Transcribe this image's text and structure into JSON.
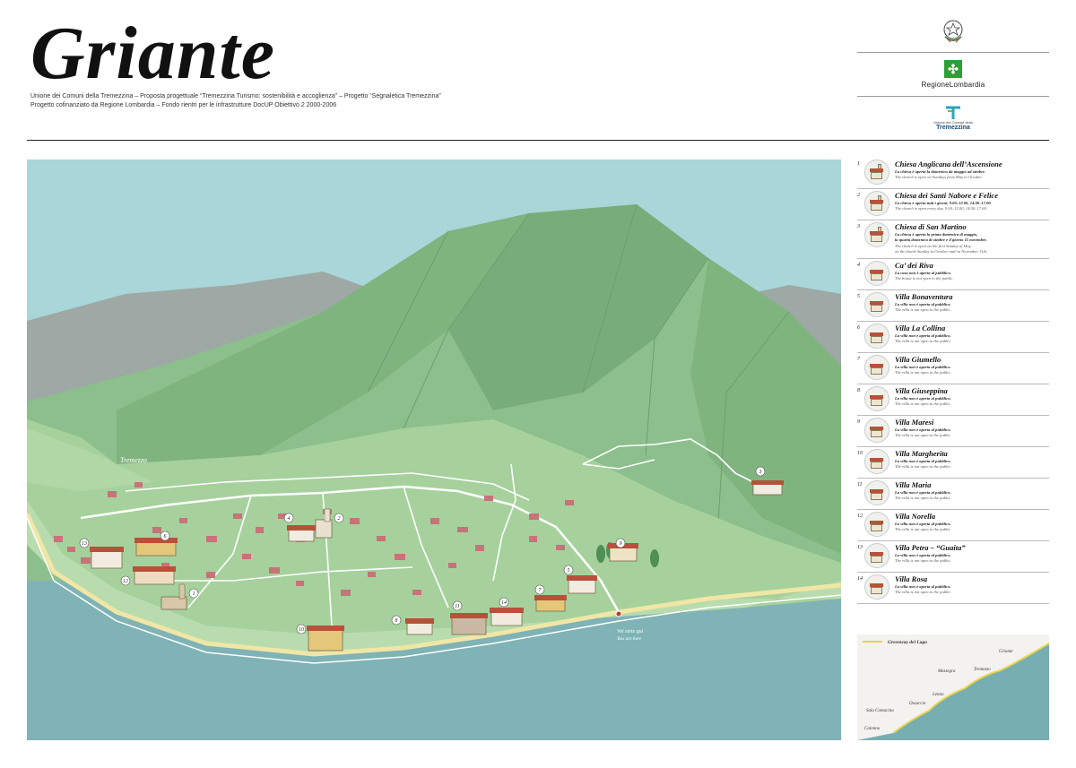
{
  "header": {
    "title": "Griante",
    "subtitle_line1": "Unione dei Comuni della Tremezzina – Proposta progettuale “Tremezzina Turismo: sostenibilità e accoglienza” – Progetto “Segnaletica Tremezzina”",
    "subtitle_line2": "Progetto cofinanziato da Regione Lombardia – Fondo rientri per le infrastrutture DocUP Obiettivo 2 2000-2006"
  },
  "logos": {
    "emblem_icon": "italian-republic-emblem-icon",
    "regione": "RegioneLombardia",
    "tremezzina_small": "Unione dei Comuni della",
    "tremezzina": "Tremezzina"
  },
  "map": {
    "place_tremezzo": "Tremezzo",
    "you_are_here_it": "Voi siete qui",
    "you_are_here_en": "You are here",
    "markers": [
      "1",
      "2",
      "3",
      "4",
      "5",
      "6",
      "7",
      "8",
      "9",
      "10",
      "11",
      "12",
      "13",
      "14"
    ],
    "colors": {
      "lake": "#7fb3b5",
      "sky": "#a9d6d8",
      "mountain": "#8fc08f",
      "land": "#b2d7a6",
      "roofs": "#c8727a",
      "road": "#ffffff",
      "shore": "#f0e6a6"
    }
  },
  "legend": [
    {
      "num": "1",
      "name": "Chiesa Anglicana dell’Ascensione",
      "it": [
        "La chiesa è aperta la domenica da maggio ad ottobre."
      ],
      "en": [
        "The church is open on Sundays from May to October."
      ],
      "thumb": "church-icon"
    },
    {
      "num": "2",
      "name": "Chiesa dei Santi Nabore e Felice",
      "it": [
        "La chiesa è aperta tutti i giorni, 9.00–12.00, 14.00–17.00."
      ],
      "en": [
        "The church is open every day, 9.00–12.00, 14.00–17.00."
      ],
      "thumb": "church-icon"
    },
    {
      "num": "3",
      "name": "Chiesa di San Martino",
      "it": [
        "La chiesa è aperta la prima domenica di maggio,",
        "la quarta domenica di ottobre e il giorno 11 novembre."
      ],
      "en": [
        "The church is open on the first Sunday of May,",
        "on the fourth Sunday in October and on November 11th."
      ],
      "thumb": "church-icon"
    },
    {
      "num": "4",
      "name": "Ca’ dei Riva",
      "it": [
        "La casa non è aperta al pubblico."
      ],
      "en": [
        "The house is not open to the public."
      ],
      "thumb": "house-icon"
    },
    {
      "num": "5",
      "name": "Villa Bonaventura",
      "it": [
        "La villa non è aperta al pubblico."
      ],
      "en": [
        "The villa is not open to the public."
      ],
      "thumb": "villa-icon"
    },
    {
      "num": "6",
      "name": "Villa La Collina",
      "it": [
        "La villa non è aperta al pubblico."
      ],
      "en": [
        "The villa is not open to the public."
      ],
      "thumb": "villa-icon"
    },
    {
      "num": "7",
      "name": "Villa Giumello",
      "it": [
        "La villa non è aperta al pubblico."
      ],
      "en": [
        "The villa is not open to the public."
      ],
      "thumb": "villa-icon"
    },
    {
      "num": "8",
      "name": "Villa Giuseppina",
      "it": [
        "La villa non è aperta al pubblico."
      ],
      "en": [
        "The villa is not open to the public."
      ],
      "thumb": "villa-icon"
    },
    {
      "num": "9",
      "name": "Villa Maresi",
      "it": [
        "La villa non è aperta al pubblico."
      ],
      "en": [
        "The villa is not open to the public."
      ],
      "thumb": "villa-icon"
    },
    {
      "num": "10",
      "name": "Villa Margherita",
      "it": [
        "La villa non è aperta al pubblico."
      ],
      "en": [
        "The villa is not open to the public."
      ],
      "thumb": "villa-icon"
    },
    {
      "num": "11",
      "name": "Villa Maria",
      "it": [
        "La villa non è aperta al pubblico."
      ],
      "en": [
        "The villa is not open to the public."
      ],
      "thumb": "villa-icon"
    },
    {
      "num": "12",
      "name": "Villa Norella",
      "it": [
        "La villa non è aperta al pubblico."
      ],
      "en": [
        "The villa is not open to the public."
      ],
      "thumb": "villa-icon"
    },
    {
      "num": "13",
      "name": "Villa Petra – “Guaita”",
      "it": [
        "La villa non è aperta al pubblico."
      ],
      "en": [
        "The villa is not open to the public."
      ],
      "thumb": "villa-icon"
    },
    {
      "num": "14",
      "name": "Villa Rosa",
      "it": [
        "La villa non è aperta al pubblico."
      ],
      "en": [
        "The villa is not open to the public."
      ],
      "thumb": "villa-icon"
    }
  ],
  "inset": {
    "legend_label": "Greenway del Lago",
    "places": [
      "Griante",
      "Tremezzo",
      "Mezzegra",
      "Lenno",
      "Ossuccio",
      "Sala Comacina",
      "Colonno"
    ],
    "colors": {
      "water": "#76aeb2",
      "land": "#f3f2ef",
      "route": "#e9d44c"
    }
  }
}
